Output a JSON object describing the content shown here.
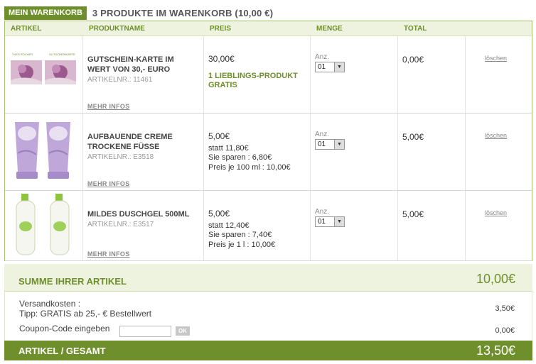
{
  "cart": {
    "badge": "MEIN WARENKORB",
    "heading": "3 PRODUKTE IM WARENKORB (10,00 €)"
  },
  "columns": {
    "artikel": "ARTIKEL",
    "produktname": "PRODUKTNAME",
    "preis": "PREIS",
    "menge": "MENGE",
    "total": "TOTAL"
  },
  "items": [
    {
      "name": "GUTSCHEIN-KARTE IM WERT VON 30,- EURO",
      "artnr": "ARTIKELNR.: 11461",
      "more": "MEHR INFOS",
      "price": "30,00€",
      "promo": "1 LIEBLINGS-PRODUKT GRATIS",
      "qty_label": "Anz.",
      "qty": "01",
      "total": "0,00€",
      "delete": "löschen",
      "image_brand_left": "YVES ROCHER",
      "image_brand_right": "GUTSCHEINKARTE"
    },
    {
      "name": "AUFBAUENDE CREME TROCKENE FÜSSE",
      "artnr": "ARTIKELNR.: E3518",
      "more": "MEHR INFOS",
      "price": "5,00€",
      "statt": "statt 11,80€",
      "sparen": "Sie sparen : 6,80€",
      "unit": "Preis je 100 ml : 10,00€",
      "qty_label": "Anz.",
      "qty": "01",
      "total": "5,00€",
      "delete": "löschen"
    },
    {
      "name": "MILDES DUSCHGEL 500ML",
      "artnr": "ARTIKELNR.: E3517",
      "more": "MEHR INFOS",
      "price": "5,00€",
      "statt": "statt 12,40€",
      "sparen": "Sie sparen : 7,40€",
      "unit": "Preis je 1 l : 10,00€",
      "qty_label": "Anz.",
      "qty": "01",
      "total": "5,00€",
      "delete": "löschen"
    }
  ],
  "summary": {
    "label": "SUMME IHRER ARTIKEL",
    "value": "10,00€",
    "shipping_label": "Versandkosten :",
    "shipping_tip": "Tipp: GRATIS ab 25,- € Bestellwert",
    "shipping_value": "3,50€",
    "coupon_label": "Coupon-Code eingeben",
    "coupon_placeholder": "",
    "coupon_button": "OK",
    "coupon_value": "0,00€",
    "grand_label": "ARTIKEL / GESAMT",
    "grand_value": "13,50€"
  },
  "colors": {
    "accent": "#6e8f2b",
    "light_green": "#eef3e0"
  }
}
